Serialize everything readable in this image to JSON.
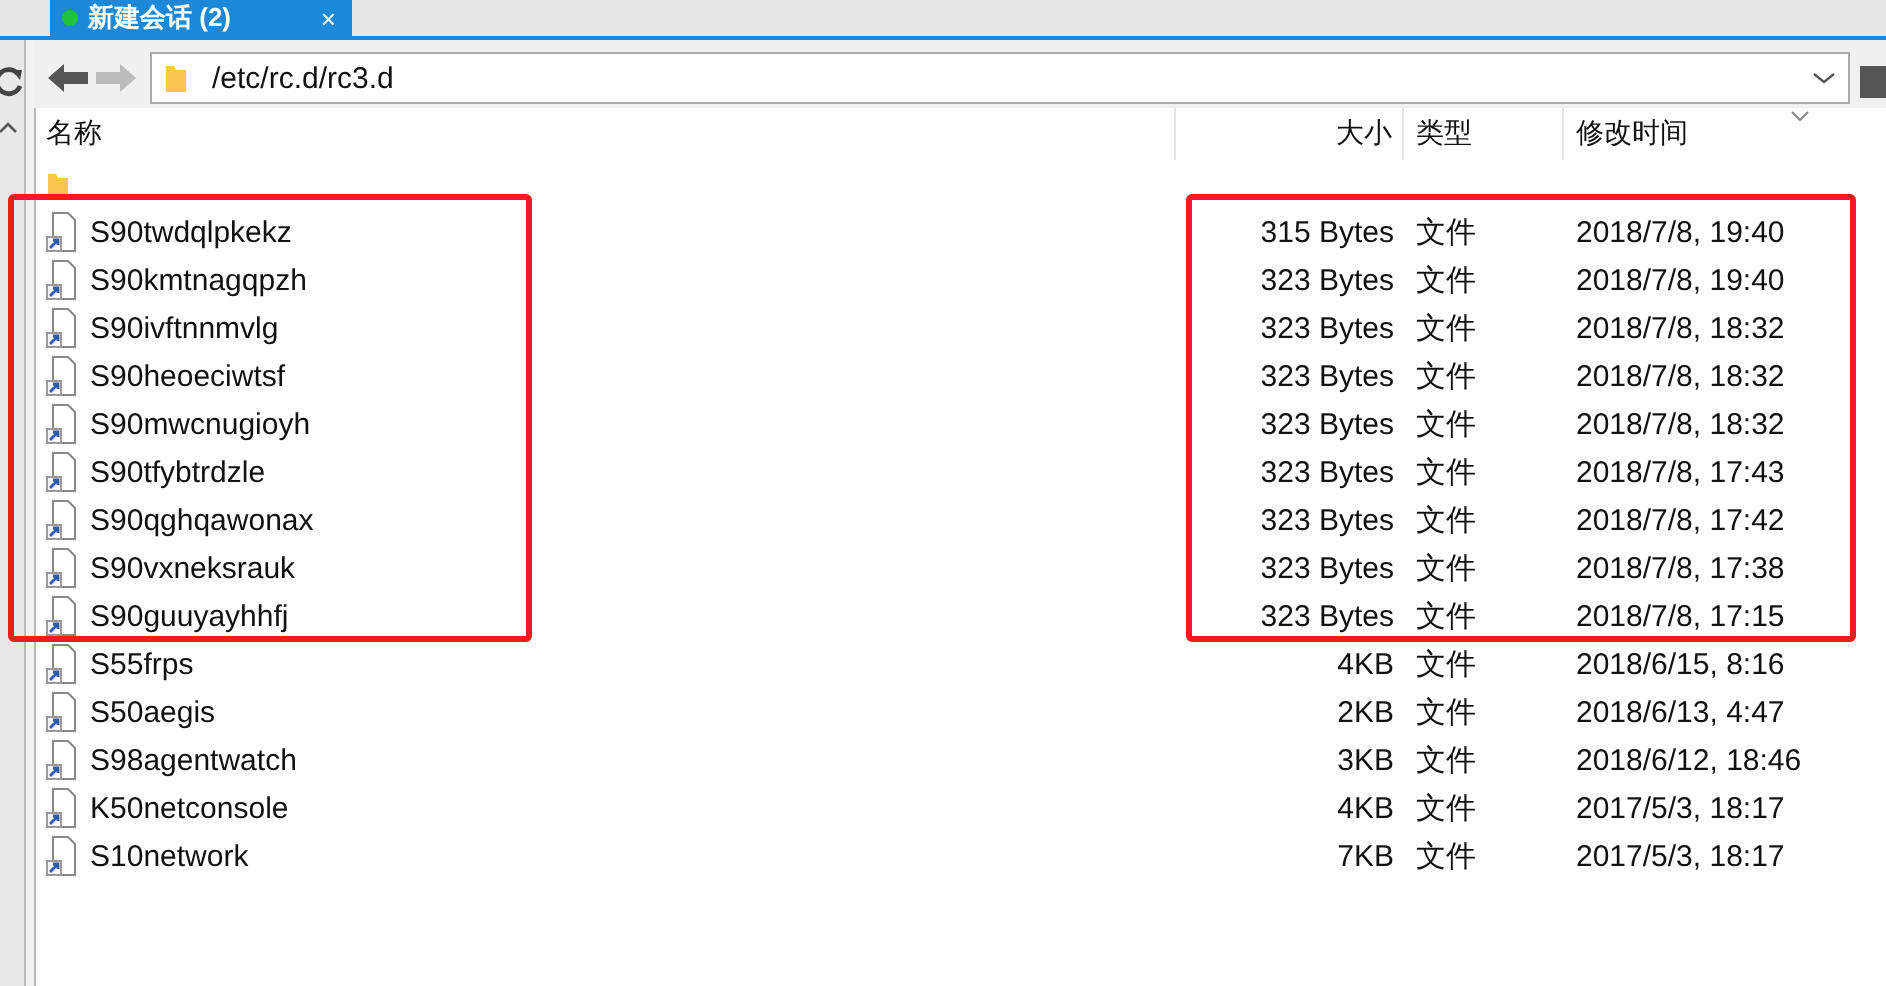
{
  "tab": {
    "label": "新建会话 (2)",
    "selected": true,
    "connected": true,
    "close": "×"
  },
  "path": "/etc/rc.d/rc3.d",
  "columns": [
    {
      "label": "名称"
    },
    {
      "label": "大小"
    },
    {
      "label": "类型"
    },
    {
      "label": "修改时间"
    }
  ],
  "groups": [
    {
      "highlighted": false,
      "rows": [
        {
          "kind": "parent_folder"
        }
      ]
    },
    {
      "highlighted": true,
      "rows": [
        {
          "kind": "file",
          "name": "S90twdqlpkekz",
          "size": "315 Bytes",
          "type": "文件",
          "modified": "2018/7/8, 19:40"
        },
        {
          "kind": "file",
          "name": "S90kmtnagqpzh",
          "size": "323 Bytes",
          "type": "文件",
          "modified": "2018/7/8, 19:40"
        },
        {
          "kind": "file",
          "name": "S90ivftnnmvlg",
          "size": "323 Bytes",
          "type": "文件",
          "modified": "2018/7/8, 18:32"
        },
        {
          "kind": "file",
          "name": "S90heoeciwtsf",
          "size": "323 Bytes",
          "type": "文件",
          "modified": "2018/7/8, 18:32"
        },
        {
          "kind": "file",
          "name": "S90mwcnugioyh",
          "size": "323 Bytes",
          "type": "文件",
          "modified": "2018/7/8, 18:32"
        },
        {
          "kind": "file",
          "name": "S90tfybtrdzle",
          "size": "323 Bytes",
          "type": "文件",
          "modified": "2018/7/8, 17:43"
        },
        {
          "kind": "file",
          "name": "S90qghqawonax",
          "size": "323 Bytes",
          "type": "文件",
          "modified": "2018/7/8, 17:42"
        },
        {
          "kind": "file",
          "name": "S90vxneksrauk",
          "size": "323 Bytes",
          "type": "文件",
          "modified": "2018/7/8, 17:38"
        },
        {
          "kind": "file",
          "name": "S90guuyayhhfj",
          "size": "323 Bytes",
          "type": "文件",
          "modified": "2018/7/8, 17:15"
        }
      ]
    },
    {
      "highlighted": false,
      "rows": [
        {
          "kind": "file",
          "name": "S55frps",
          "size": "4KB",
          "type": "文件",
          "modified": "2018/6/15, 8:16"
        },
        {
          "kind": "file",
          "name": "S50aegis",
          "size": "2KB",
          "type": "文件",
          "modified": "2018/6/13, 4:47"
        },
        {
          "kind": "file",
          "name": "S98agentwatch",
          "size": "3KB",
          "type": "文件",
          "modified": "2018/6/12, 18:46"
        },
        {
          "kind": "file",
          "name": "K50netconsole",
          "size": "4KB",
          "type": "文件",
          "modified": "2017/5/3, 18:17"
        },
        {
          "kind": "file",
          "name": "S10network",
          "size": "7KB",
          "type": "文件",
          "modified": "2017/5/3, 18:17"
        }
      ]
    }
  ]
}
